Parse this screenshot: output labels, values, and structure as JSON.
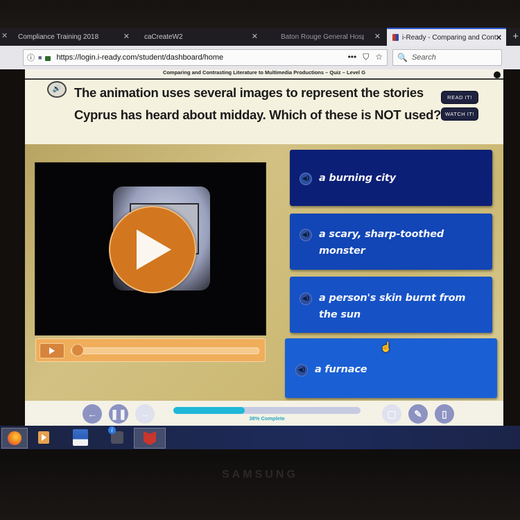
{
  "browser": {
    "tabs": [
      {
        "label": "Compliance Training 2018",
        "active": false
      },
      {
        "label": "caCreateW2",
        "active": false
      },
      {
        "label": "Baton Rouge General  Hosp",
        "active": false
      },
      {
        "label": "i-Ready - Comparing and Cont",
        "active": true
      }
    ],
    "close_glyph": "✕",
    "new_tab_glyph": "+",
    "url": "https://login.i-ready.com/student/dashboard/home",
    "info_icon": "ⓘ",
    "more_glyph": "•••",
    "pocket_glyph": "⛉",
    "star_glyph": "☆",
    "search_icon": "🔍",
    "search_placeholder": "Search"
  },
  "lesson": {
    "title": "Comparing and Contrasting Literature to Multimedia Productions – Quiz – Level G",
    "question": "The animation uses several images to represent the stories Cyprus has heard about midday. Which of these is NOT used?",
    "speaker_glyph": "🔊",
    "read_it_label": "READ IT!",
    "watch_it_label": "WATCH IT!"
  },
  "video": {
    "progress": 0.0
  },
  "answers": [
    {
      "text": "a burning city"
    },
    {
      "text": "a scary, sharp-toothed monster"
    },
    {
      "text": "a person's skin burnt from the sun"
    },
    {
      "text": "a furnace"
    }
  ],
  "answer_speaker_glyph": "◀)",
  "footer": {
    "back_glyph": "←",
    "pause_glyph": "❚❚",
    "forward_glyph": "→",
    "progress_percent": 38,
    "progress_label": "38% Complete",
    "calc_glyph": "▢",
    "pencil_glyph": "✎",
    "notes_glyph": "▯"
  },
  "monitor": {
    "brand": "SAMSUNG"
  },
  "cursor_glyph": "☝"
}
